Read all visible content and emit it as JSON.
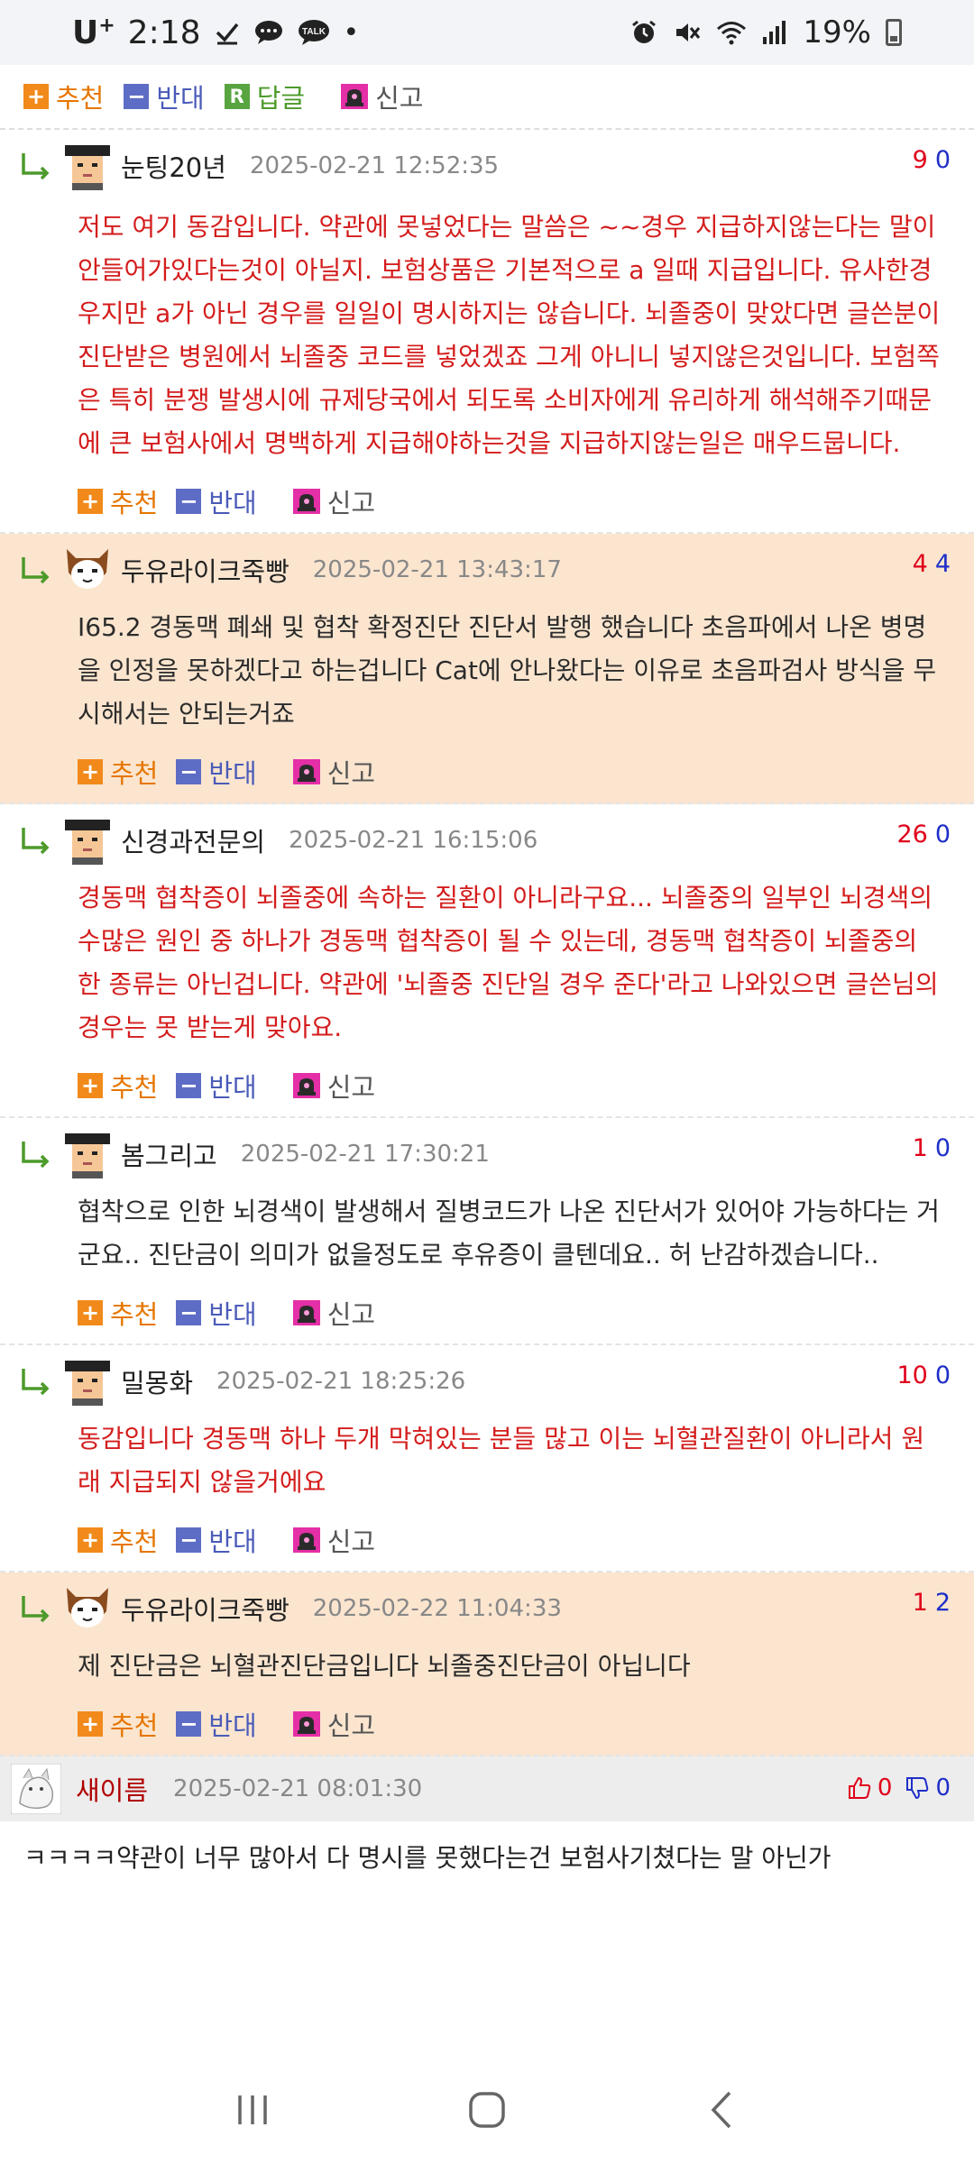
{
  "status": {
    "carrier": "U",
    "time": "2:18",
    "battery": "19%"
  },
  "labels": {
    "recommend": "추천",
    "oppose": "반대",
    "reply": "답글",
    "report": "신고"
  },
  "comments": [
    {
      "nick": "눈팅20년",
      "date": "2025-02-21 12:52:35",
      "up": "9",
      "down": "0",
      "text": "저도 여기 동감입니다. 약관에 못넣었다는 말씀은 ~~경우 지급하지않는다는 말이 안들어가있다는것이 아닐지. 보험상품은 기본적으로 a 일때 지급입니다. 유사한경우지만 a가 아닌 경우를 일일이 명시하지는 않습니다. 뇌졸중이 맞았다면 글쓴분이 진단받은 병원에서 뇌졸중 코드를 넣었겠죠 그게 아니니 넣지않은것입니다. 보험쪽은 특히 분쟁 발생시에 규제당국에서 되도록 소비자에게 유리하게 해석해주기때문에 큰 보험사에서 명백하게 지급해야하는것을 지급하지않는일은 매우드뭅니다."
    },
    {
      "nick": "두유라이크죽빵",
      "date": "2025-02-21 13:43:17",
      "up": "4",
      "down": "4",
      "text": "I65.2 경동맥 폐쇄 및 협착 확정진단 진단서 발행 했습니다 초음파에서 나온 병명을 인정을 못하겠다고 하는겁니다 Cat에 안나왔다는 이유로 초음파검사 방식을 무시해서는 안되는거죠"
    },
    {
      "nick": "신경과전문의",
      "date": "2025-02-21 16:15:06",
      "up": "26",
      "down": "0",
      "text": "경동맥 협착증이 뇌졸중에 속하는 질환이 아니라구요... 뇌졸중의 일부인 뇌경색의 수많은 원인 중 하나가 경동맥 협착증이 될 수 있는데, 경동맥 협착증이 뇌졸중의 한 종류는 아닌겁니다. 약관에 '뇌졸중 진단일 경우 준다'라고 나와있으면 글쓴님의 경우는 못 받는게 맞아요."
    },
    {
      "nick": "봄그리고",
      "date": "2025-02-21 17:30:21",
      "up": "1",
      "down": "0",
      "text": "협착으로 인한 뇌경색이 발생해서 질병코드가 나온 진단서가 있어야 가능하다는 거군요.. 진단금이 의미가 없을정도로 후유증이 클텐데요.. 허 난감하겠습니다.."
    },
    {
      "nick": "밀몽화",
      "date": "2025-02-21 18:25:26",
      "up": "10",
      "down": "0",
      "text": "동감입니다 경동맥 하나 두개 막혀있는 분들 많고 이는 뇌혈관질환이 아니라서 원래 지급되지 않을거에요"
    },
    {
      "nick": "두유라이크죽빵",
      "date": "2025-02-22 11:04:33",
      "up": "1",
      "down": "2",
      "text": "제 진단금은 뇌혈관진단금입니다 뇌졸중진단금이 아닙니다"
    }
  ],
  "top_comment": {
    "nick": "새이름",
    "date": "2025-02-21 08:01:30",
    "up": "0",
    "down": "0",
    "text": "ㅋㅋㅋㅋ약관이 너무 많아서 다 명시를 못했다는건 보험사기쳤다는 말 아닌가"
  },
  "colors": {
    "highlight_bg": "#fbe5cf",
    "red_text": "#d41c1c",
    "up_vote": "#e0001a",
    "down_vote": "#1f2fc8"
  }
}
